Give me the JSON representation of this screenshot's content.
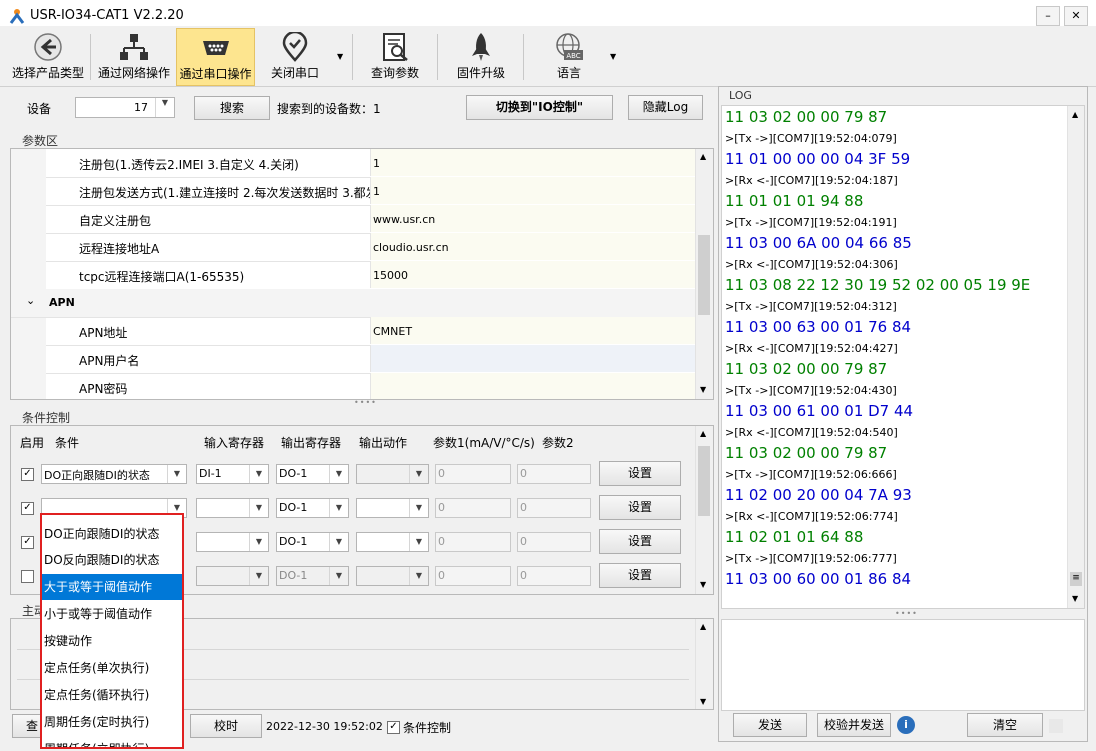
{
  "window": {
    "title": "USR-IO34-CAT1 V2.2.20",
    "controls": [
      "–",
      "✕"
    ]
  },
  "toolbar": {
    "items": [
      {
        "label": "选择产品类型",
        "icon": "back-arrow-icon"
      },
      {
        "label": "通过网络操作",
        "icon": "network-icon"
      },
      {
        "label": "通过串口操作",
        "icon": "serial-port-icon"
      },
      {
        "label": "关闭串口",
        "icon": "location-check-icon"
      },
      {
        "label": "查询参数",
        "icon": "query-params-icon"
      },
      {
        "label": "固件升级",
        "icon": "rocket-icon"
      },
      {
        "label": "语言",
        "icon": "globe-abc-icon"
      }
    ]
  },
  "device_bar": {
    "device_label": "设备",
    "device_value": "17",
    "search_button": "搜索",
    "found_label": "搜索到的设备数：1",
    "switch_button": "切换到\"IO控制\"",
    "hide_log_button": "隐藏Log"
  },
  "params": {
    "section_title": "参数区",
    "rows": [
      {
        "key": "注册包(1.透传云2.IMEI 3.自定义 4.关闭)",
        "value": "1"
      },
      {
        "key": "注册包发送方式(1.建立连接时 2.每次发送数据时 3.都发",
        "value": "1"
      },
      {
        "key": "自定义注册包",
        "value": "www.usr.cn"
      },
      {
        "key": "远程连接地址A",
        "value": "cloudio.usr.cn"
      },
      {
        "key": "tcpc远程连接端口A(1-65535)",
        "value": "15000"
      }
    ],
    "group_label": "APN",
    "group_chevron": "⌄",
    "apn_rows": [
      {
        "key": "APN地址",
        "value": "CMNET"
      },
      {
        "key": "APN用户名",
        "value": ""
      },
      {
        "key": "APN密码",
        "value": ""
      }
    ]
  },
  "conditions": {
    "section_title": "条件控制",
    "headers": [
      "启用",
      "条件",
      "输入寄存器",
      "输出寄存器",
      "输出动作",
      "参数1(mA/V/°C/s)",
      "参数2"
    ],
    "rows": [
      {
        "checked": "✓",
        "condition": "DO正向跟随DI的状态",
        "input": "DI-1",
        "output": "DO-1",
        "action": "",
        "p1": "0",
        "p2": "0",
        "set": "设置"
      },
      {
        "checked": "✓",
        "condition": "",
        "input": "",
        "output": "DO-1",
        "action": "",
        "p1": "0",
        "p2": "0",
        "set": "设置"
      },
      {
        "checked": "✓",
        "condition": "",
        "input": "",
        "output": "DO-1",
        "action": "",
        "p1": "0",
        "p2": "0",
        "set": "设置"
      },
      {
        "checked": "",
        "condition": "",
        "input": "",
        "output": "DO-1",
        "action": "",
        "p1": "0",
        "p2": "0",
        "set": "设置"
      }
    ],
    "dropdown_options": [
      "DO正向跟随DI的状态",
      "DO反向跟随DI的状态",
      "大于或等于阈值动作",
      "小于或等于阈值动作",
      "按键动作",
      "定点任务(单次执行)",
      "定点任务(循环执行)",
      "周期任务(定时执行)",
      "周期任务(立即执行)"
    ],
    "selected_option_index": 2
  },
  "active_report": {
    "section_title_partial": "主动"
  },
  "bottom_bar": {
    "left_button_partial": "查",
    "timing_button": "校时",
    "datetime": "2022-12-30 19:52:02 5",
    "condition_control_label": "条件控制",
    "condition_control_checked": "✓"
  },
  "log": {
    "title": "LOG",
    "entries": [
      {
        "text": "11 03 02 00 00 79 87",
        "kind": "hex",
        "color": "#008000"
      },
      {
        "text": ">[Tx ->][COM7][19:52:04:079]",
        "kind": "meta"
      },
      {
        "text": "11 01 00 00 00 04 3F 59",
        "kind": "hex",
        "color": "#0000cc"
      },
      {
        "text": ">[Rx <-][COM7][19:52:04:187]",
        "kind": "meta"
      },
      {
        "text": "11 01 01 01 94 88",
        "kind": "hex",
        "color": "#008000"
      },
      {
        "text": ">[Tx ->][COM7][19:52:04:191]",
        "kind": "meta"
      },
      {
        "text": "11 03 00 6A 00 04 66 85",
        "kind": "hex",
        "color": "#0000cc"
      },
      {
        "text": ">[Rx <-][COM7][19:52:04:306]",
        "kind": "meta"
      },
      {
        "text": "11 03 08 22 12 30 19 52 02 00 05 19 9E",
        "kind": "hex",
        "color": "#008000"
      },
      {
        "text": ">[Tx ->][COM7][19:52:04:312]",
        "kind": "meta"
      },
      {
        "text": "11 03 00 63 00 01 76 84",
        "kind": "hex",
        "color": "#0000cc"
      },
      {
        "text": ">[Rx <-][COM7][19:52:04:427]",
        "kind": "meta"
      },
      {
        "text": "11 03 02 00 00 79 87",
        "kind": "hex",
        "color": "#008000"
      },
      {
        "text": ">[Tx ->][COM7][19:52:04:430]",
        "kind": "meta"
      },
      {
        "text": "11 03 00 61 00 01 D7 44",
        "kind": "hex",
        "color": "#0000cc"
      },
      {
        "text": ">[Rx <-][COM7][19:52:04:540]",
        "kind": "meta"
      },
      {
        "text": "11 03 02 00 00 79 87",
        "kind": "hex",
        "color": "#008000"
      },
      {
        "text": ">[Tx ->][COM7][19:52:06:666]",
        "kind": "meta"
      },
      {
        "text": "11 02 00 20 00 04 7A 93",
        "kind": "hex",
        "color": "#0000cc"
      },
      {
        "text": ">[Rx <-][COM7][19:52:06:774]",
        "kind": "meta"
      },
      {
        "text": "11 02 01 01 64 88",
        "kind": "hex",
        "color": "#008000"
      },
      {
        "text": ">[Tx ->][COM7][19:52:06:777]",
        "kind": "meta"
      },
      {
        "text": "11 03 00 60 00 01 86 84",
        "kind": "hex",
        "color": "#0000cc"
      }
    ],
    "send_button": "发送",
    "verify_send_button": "校验并发送",
    "info_icon_glyph": "i",
    "clear_button": "清空"
  },
  "colors": {
    "active_toolbar": "#fde58f",
    "dropdown_highlight": "#0078d7",
    "dropdown_border": "#e02020",
    "hex_green": "#008000",
    "hex_blue": "#0000cc"
  }
}
